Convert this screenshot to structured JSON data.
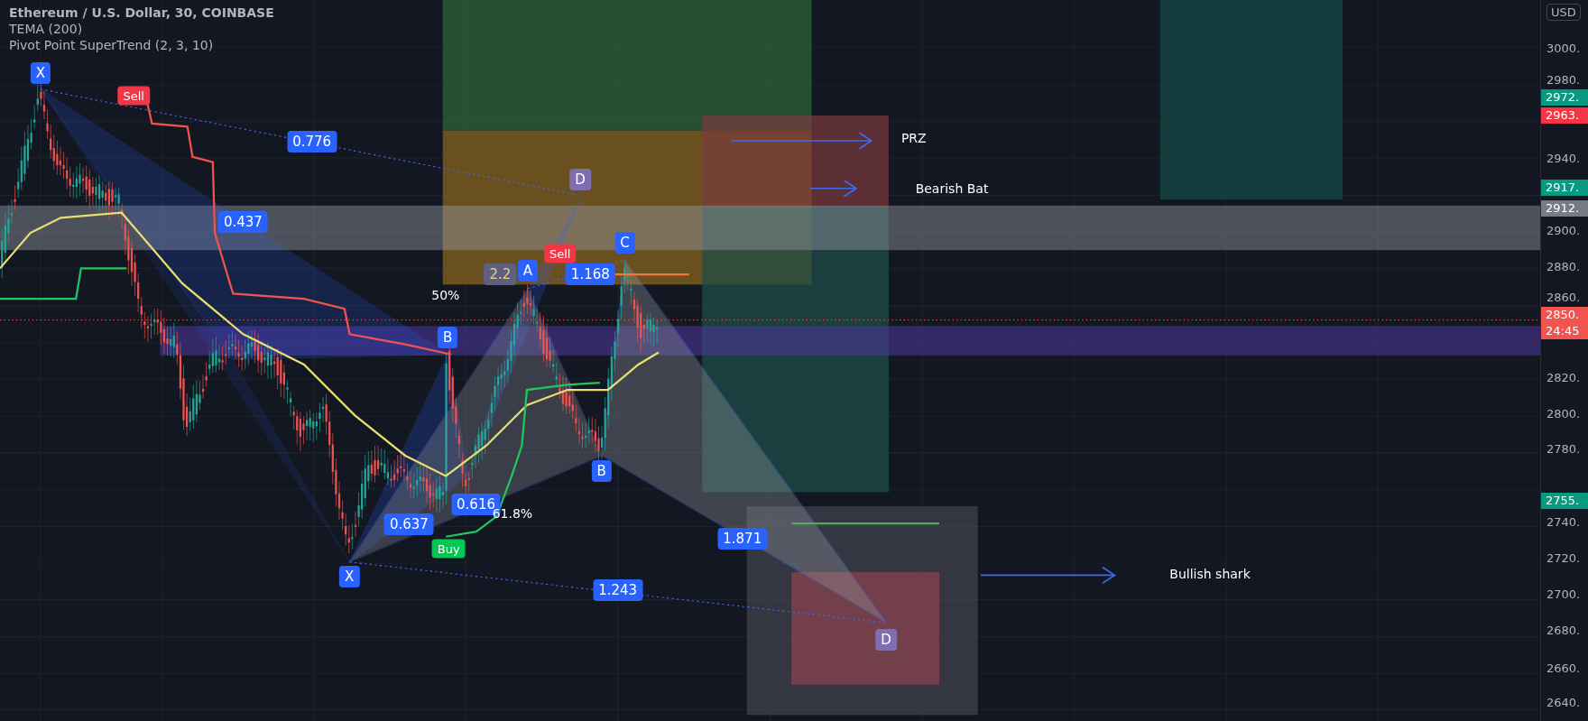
{
  "legend": {
    "title": "Ethereum / U.S. Dollar, 30, COINBASE",
    "indicators": [
      "TEMA (200)",
      "Pivot Point SuperTrend (2, 3, 10)"
    ]
  },
  "markers": [
    {
      "kind": "point",
      "text": "X"
    },
    {
      "kind": "sell",
      "text": "Sell"
    },
    {
      "kind": "ratio",
      "text": "0.776"
    },
    {
      "kind": "ratio",
      "text": "0.437"
    },
    {
      "kind": "point-d",
      "text": "D"
    },
    {
      "kind": "percent",
      "text": "50%"
    },
    {
      "kind": "ratio-faded",
      "text": "2.2"
    },
    {
      "kind": "point",
      "text": "A"
    },
    {
      "kind": "sell",
      "text": "Sell"
    },
    {
      "kind": "ratio",
      "text": "1.168"
    },
    {
      "kind": "point",
      "text": "C"
    },
    {
      "kind": "point",
      "text": "B"
    },
    {
      "kind": "ratio",
      "text": "0.616"
    },
    {
      "kind": "ratio",
      "text": "0.637"
    },
    {
      "kind": "percent",
      "text": "61.8%"
    },
    {
      "kind": "buy",
      "text": "Buy"
    },
    {
      "kind": "point",
      "text": "X"
    },
    {
      "kind": "point",
      "text": "B"
    },
    {
      "kind": "ratio",
      "text": "1.871"
    },
    {
      "kind": "ratio",
      "text": "1.243"
    },
    {
      "kind": "point-d",
      "text": "D"
    },
    {
      "kind": "note",
      "text": "PRZ"
    },
    {
      "kind": "note",
      "text": "Bearish Bat"
    },
    {
      "kind": "note",
      "text": "Bullish shark"
    }
  ],
  "price_axis": {
    "currency": "USD",
    "ticks": [
      "3000.",
      "2980.",
      "2940.",
      "2900.",
      "2880.",
      "2860.",
      "2820.",
      "2800.",
      "2780.",
      "2740.",
      "2720.",
      "2700.",
      "2680.",
      "2660.",
      "2640."
    ],
    "tags": [
      {
        "text": "2972.",
        "color": "#089981"
      },
      {
        "text": "2963.",
        "color": "#f23645"
      },
      {
        "text": "2917.",
        "color": "#089981"
      },
      {
        "text": "2912.",
        "color": "#787b86"
      },
      {
        "text": "2850.",
        "color": "#f05350"
      },
      {
        "text": "24:45",
        "color": "#f05350"
      },
      {
        "text": "2755.",
        "color": "#089981"
      }
    ]
  }
}
